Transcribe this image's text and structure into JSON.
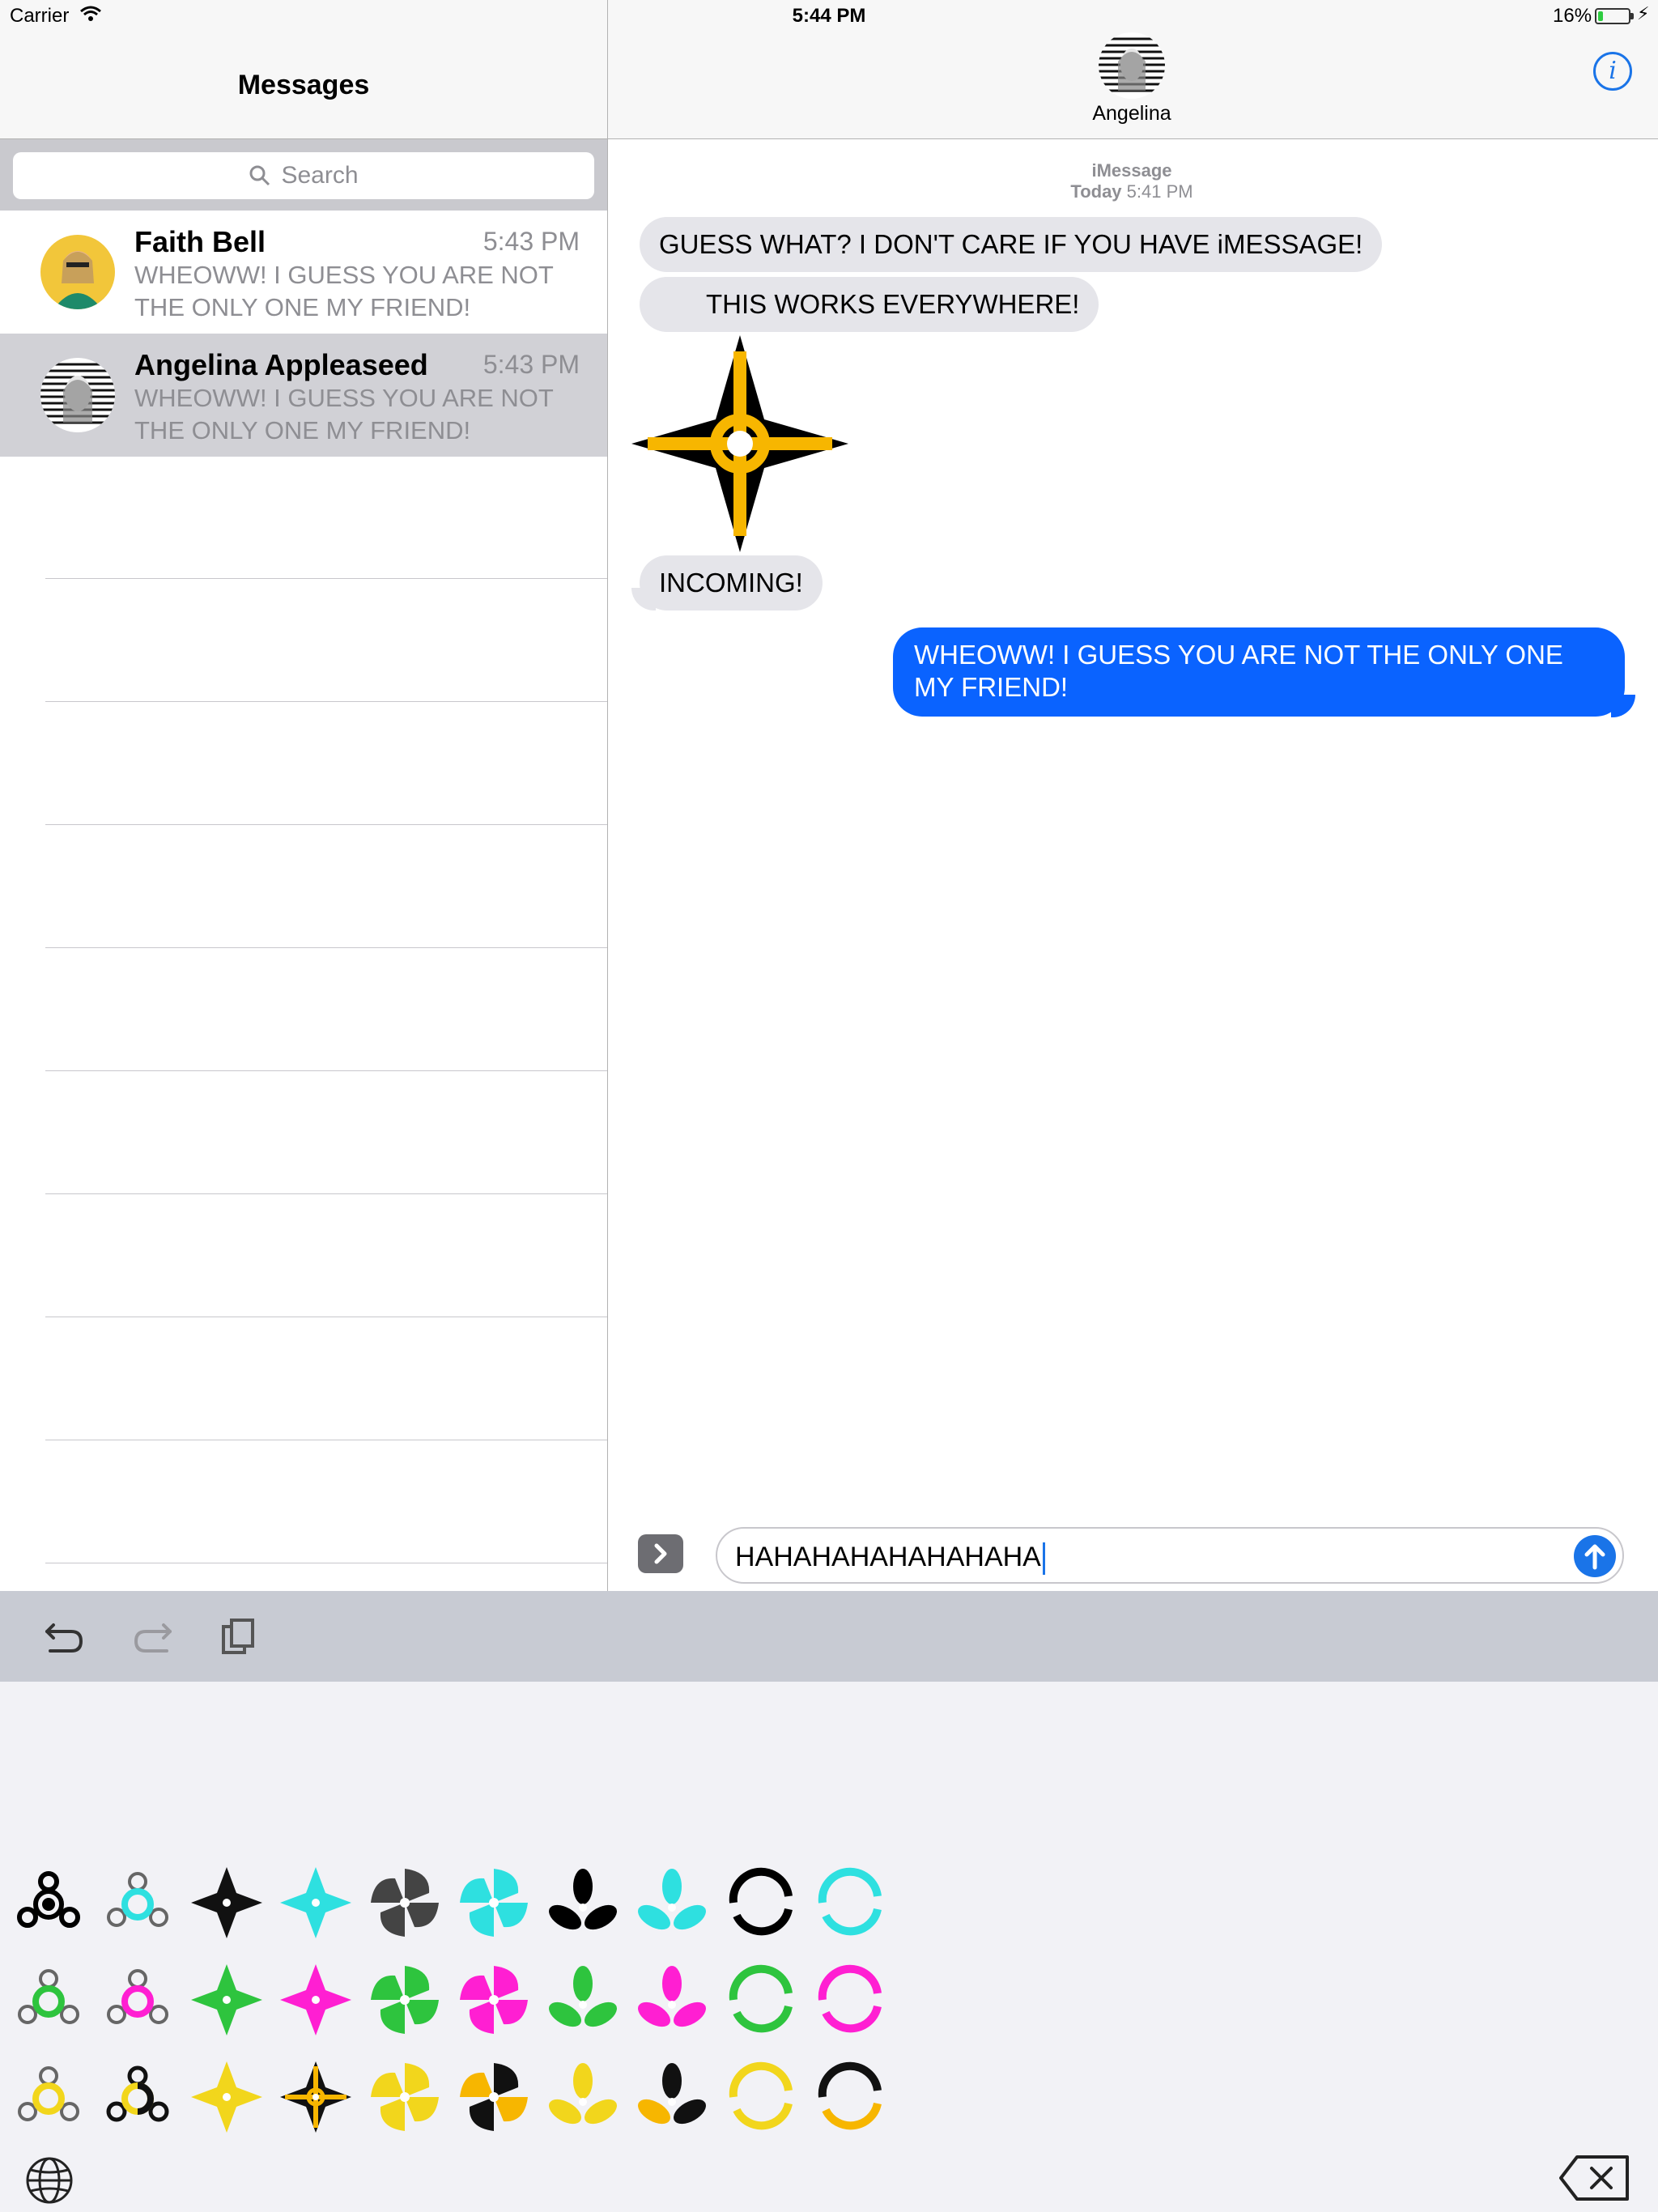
{
  "status_bar": {
    "carrier": "Carrier",
    "time": "5:44 PM",
    "battery": "16%",
    "battery_level": 0.16
  },
  "sidebar": {
    "title": "Messages",
    "search_placeholder": "Search",
    "conversations": [
      {
        "name": "Faith Bell",
        "time": "5:43 PM",
        "preview": "WHEOWW! I GUESS YOU ARE NOT THE ONLY ONE MY FRIEND!",
        "selected": false
      },
      {
        "name": "Angelina Appleaseed",
        "time": "5:43 PM",
        "preview": "WHEOWW! I GUESS YOU ARE NOT THE ONLY ONE MY FRIEND!",
        "selected": true
      }
    ]
  },
  "chat": {
    "contact_name": "Angelina",
    "service": "iMessage",
    "timestamp_day": "Today",
    "timestamp_time": "5:41 PM",
    "messages": [
      {
        "from": "them",
        "text": "GUESS WHAT? I DON'T CARE IF YOU HAVE iMESSAGE!"
      },
      {
        "from": "them",
        "text": "THIS WORKS EVERYWHERE!"
      },
      {
        "from": "them",
        "sticker": "ninja-star-black-yellow"
      },
      {
        "from": "them",
        "text": "INCOMING!"
      },
      {
        "from": "me",
        "text": "WHEOWW! I GUESS YOU ARE NOT THE ONLY ONE MY FRIEND!"
      }
    ],
    "input_value": "HAHAHAHAHAHAHAHA"
  },
  "keyboard": {
    "toolbar": [
      "undo-icon",
      "redo-icon",
      "paste-icon"
    ],
    "sticker_colors": {
      "row1": [
        "#000000",
        "#2ee0e0"
      ],
      "row2": [
        "#2ec43e",
        "#ff1fd2"
      ],
      "row3": [
        "#f2d61c",
        "#000000"
      ]
    },
    "sticker_kinds": [
      "spinner",
      "star",
      "pinwheel",
      "trefoil",
      "ring"
    ]
  }
}
